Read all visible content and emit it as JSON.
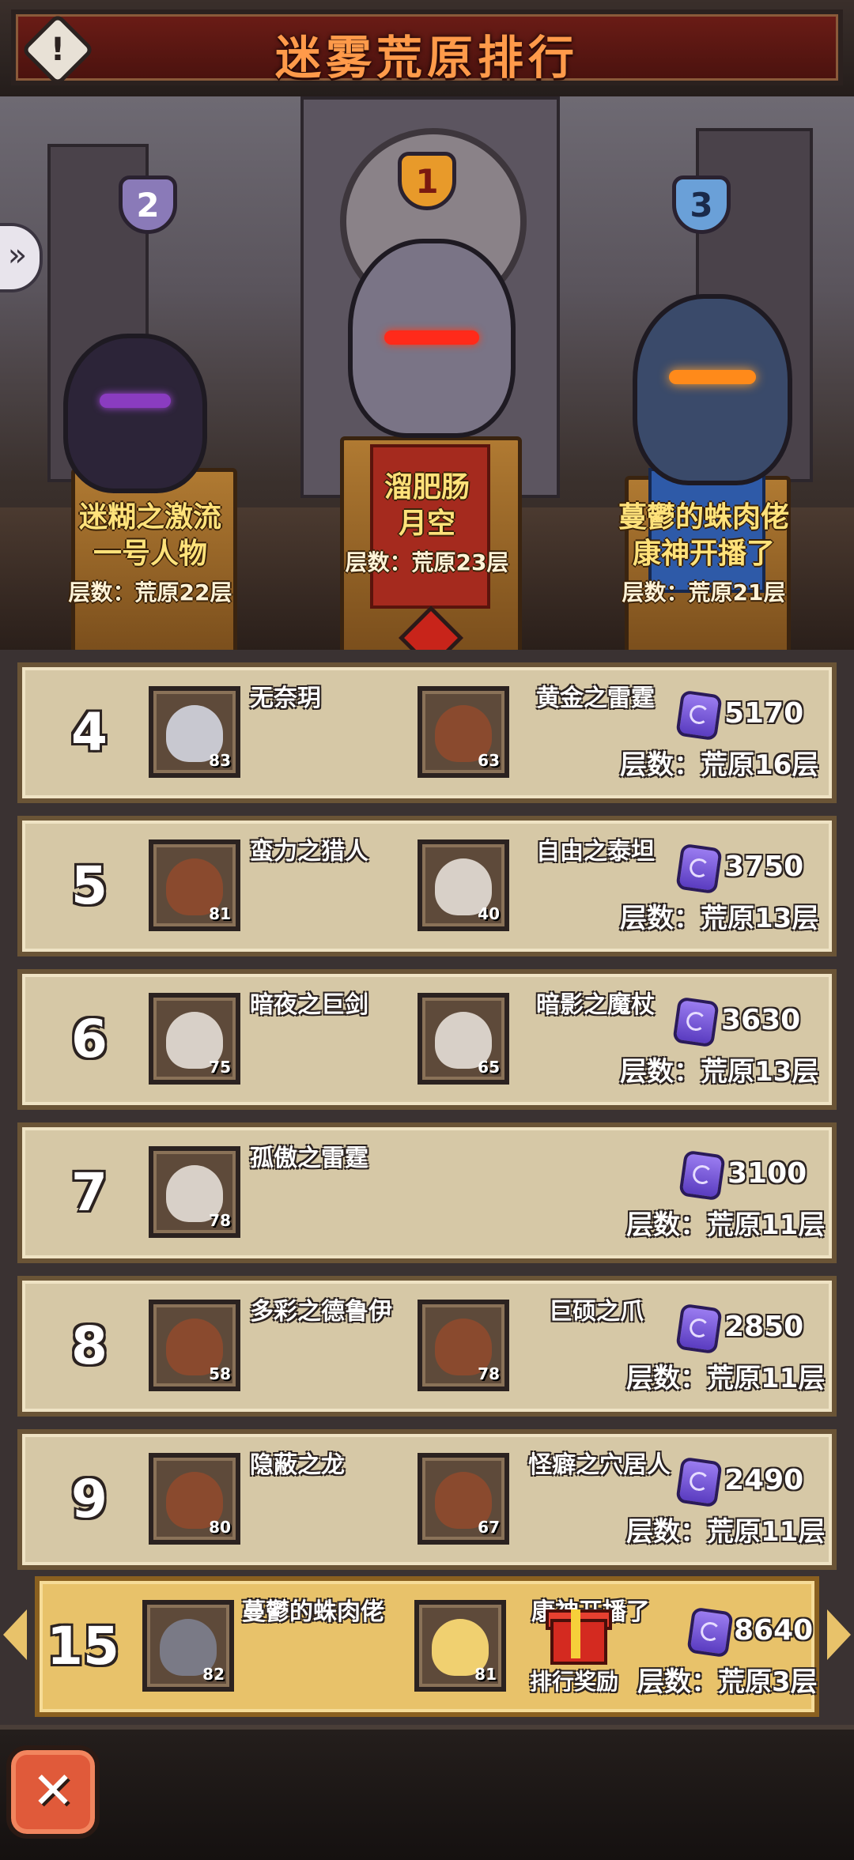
{
  "header": {
    "title": "迷雾荒原排行",
    "info_icon": "!"
  },
  "podium": [
    {
      "rank": "2",
      "guild": "迷糊之激流",
      "name": "一号人物",
      "layer": "层数：荒原22层"
    },
    {
      "rank": "1",
      "guild": "溜肥肠",
      "name": "月空",
      "layer": "层数：荒原23层"
    },
    {
      "rank": "3",
      "guild": "蔓鬱的蛛肉佬",
      "name": "康神开播了",
      "layer": "层数：荒原21层"
    }
  ],
  "rows": [
    {
      "rank": "4",
      "p1": {
        "name": "无奈玥",
        "level": "83"
      },
      "p2": {
        "name": "黄金之雷霆",
        "level": "63"
      },
      "score": "5170",
      "layer": "层数：荒原16层"
    },
    {
      "rank": "5",
      "p1": {
        "name": "蛮力之猎人",
        "level": "81"
      },
      "p2": {
        "name": "自由之泰坦",
        "level": "40"
      },
      "score": "3750",
      "layer": "层数：荒原13层"
    },
    {
      "rank": "6",
      "p1": {
        "name": "暗夜之巨剑",
        "level": "75"
      },
      "p2": {
        "name": "暗影之魔杖",
        "level": "65"
      },
      "score": "3630",
      "layer": "层数：荒原13层"
    },
    {
      "rank": "7",
      "p1": {
        "name": "孤傲之雷霆",
        "level": "78"
      },
      "score": "3100",
      "layer": "层数：荒原11层"
    },
    {
      "rank": "8",
      "p1": {
        "name": "多彩之德鲁伊",
        "level": "58"
      },
      "p2": {
        "name": "巨硕之爪",
        "level": "78"
      },
      "score": "2850",
      "layer": "层数：荒原11层"
    },
    {
      "rank": "9",
      "p1": {
        "name": "隐蔽之龙",
        "level": "80"
      },
      "p2": {
        "name": "怪癖之穴居人",
        "level": "67"
      },
      "score": "2490",
      "layer": "层数：荒原11层"
    }
  ],
  "my_row": {
    "rank": "15",
    "p1": {
      "name": "蔓鬱的蛛肉佬",
      "level": "82"
    },
    "p2": {
      "name": "康神开播了",
      "level": "81"
    },
    "score": "8640",
    "layer": "层数：荒原3层",
    "reward_label": "排行奖励"
  },
  "close_icon": "✕",
  "side_arrow_icon": "»",
  "colors": {
    "row_bg": "#d6c8a6",
    "my_row_bg": "#e8c26a",
    "title": "#ff9a4a",
    "gem": "#7a5cf0"
  }
}
